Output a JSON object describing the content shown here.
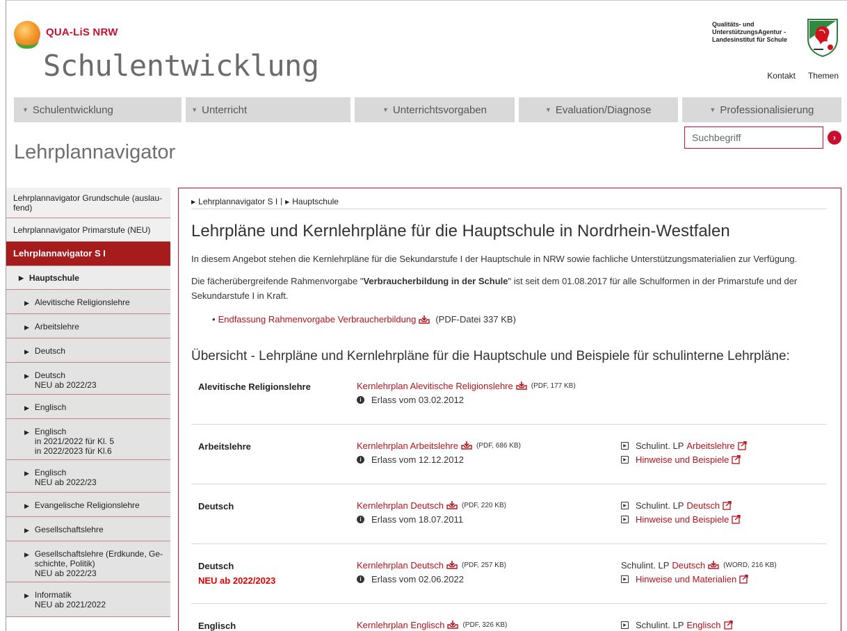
{
  "header": {
    "brand": "QUA-LiS NRW",
    "site_title": "Schulentwicklung",
    "agency_line1": "Qualitäts- und",
    "agency_line2": "UnterstützungsAgentur -",
    "agency_line3": "Landesinstitut für Schule",
    "links": [
      "Kontakt",
      "Themen"
    ]
  },
  "nav": [
    "Schulentwicklung",
    "Unterricht",
    "Unterrichtsvorgaben",
    "Evaluation/Diagnose",
    "Professionalisierung"
  ],
  "search": {
    "placeholder": "Suchbegriff"
  },
  "page_heading": "Lehrplannavigator",
  "sidebar": {
    "items": [
      {
        "label": "Lehrplannavigator Grundschule (auslau-",
        "label2": "fend)"
      },
      {
        "label": "Lehrplannavigator Primarstufe (NEU)"
      },
      {
        "label": "Lehrplannavigator S I"
      },
      {
        "label": "Hauptschule"
      },
      {
        "label": "Alevitische Religionslehre"
      },
      {
        "label": "Arbeitslehre"
      },
      {
        "label": "Deutsch"
      },
      {
        "label": "Deutsch",
        "label2": "NEU ab 2022/23"
      },
      {
        "label": "Englisch"
      },
      {
        "label": "Englisch",
        "label2": "in 2021/2022 für Kl. 5",
        "label3": "in 2022/2023 für Kl.6"
      },
      {
        "label": "Englisch",
        "label2": "NEU ab 2022/23"
      },
      {
        "label": "Evangelische Religionslehre"
      },
      {
        "label": "Gesellschaftslehre"
      },
      {
        "label": "Gesellschaftslehre (Erdkunde, Ge-",
        "label2": "schichte, Politik)",
        "label3": "NEU ab 2022/23"
      },
      {
        "label": "Informatik",
        "label2": "NEU ab 2021/2022"
      }
    ]
  },
  "main": {
    "breadcrumb": [
      "Lehrplannavigator S I",
      "Hauptschule"
    ],
    "title": "Lehrpläne und Kernlehrpläne für die Hauptschule in Nordrhein-Westfalen",
    "intro": "In diesem Angebot stehen die Kernlehrpläne für die Sekundarstufe I der Hauptschule in NRW sowie fachliche Unterstützungsmaterialien zur Verfügung.",
    "intro2_pre": "Die fächerübergreifende Rahmenvorgabe \"",
    "intro2_bold": "Verbraucherbildung in der Schule",
    "intro2_post": "\" ist seit dem 01.08.2017 für alle Schulformen in der Primarstufe und der Sekundarstufe I in Kraft.",
    "bullet_link": "Endfassung Rahmenvorgabe Verbraucherbildung",
    "bullet_meta": "(PDF-Datei 337 KB)",
    "overview_title": "Übersicht - Lehrpläne und Kernlehrpläne für die Hauptschule und Beispiele für schulinterne Lehrpläne:",
    "rows": [
      {
        "subject": "Alevitische Religionslehre",
        "neu": "",
        "plan": "Kernlehrplan Alevitische Religionslehre",
        "plan_meta": "(PDF, 177 KB)",
        "erlass": "Erlass vom 03.02.2012",
        "schulint_prefix": "",
        "schulint_link": "",
        "schulint_meta": "",
        "hinweise": ""
      },
      {
        "subject": "Arbeitslehre",
        "neu": "",
        "plan": "Kernlehrplan Arbeitslehre",
        "plan_meta": "(PDF, 686 KB)",
        "erlass": "Erlass vom 12.12.2012",
        "schulint_prefix": "Schulint. LP",
        "schulint_link": "Arbeitslehre",
        "schulint_meta": "",
        "hinweise": "Hinweise und Beispiele"
      },
      {
        "subject": "Deutsch",
        "neu": "",
        "plan": "Kernlehrplan Deutsch",
        "plan_meta": "(PDF, 220 KB)",
        "erlass": "Erlass vom 18.07.2011",
        "schulint_prefix": "Schulint. LP",
        "schulint_link": "Deutsch",
        "schulint_meta": "",
        "hinweise": "Hinweise und Beispiele"
      },
      {
        "subject": "Deutsch",
        "neu": "NEU ab 2022/2023",
        "plan": "Kernlehrplan Deutsch",
        "plan_meta": "(PDF, 257 KB)",
        "erlass": "Erlass vom 02.06.2022",
        "schulint_prefix": "Schulint. LP",
        "schulint_link": "Deutsch",
        "schulint_meta": "(WORD, 216 KB)",
        "hinweise": "Hinweise und Materialien"
      },
      {
        "subject": "Englisch",
        "neu": "",
        "plan": "Kernlehrplan Englisch",
        "plan_meta": "(PDF, 326 KB)",
        "erlass": "",
        "schulint_prefix": "Schulint. LP",
        "schulint_link": "Englisch",
        "schulint_meta": "",
        "hinweise": ""
      }
    ]
  },
  "colors": {
    "accent": "#b5121b",
    "sidebar_active": "#a61c1c",
    "nav_bg": "#d9d9d9",
    "neu_red": "#e00000"
  }
}
